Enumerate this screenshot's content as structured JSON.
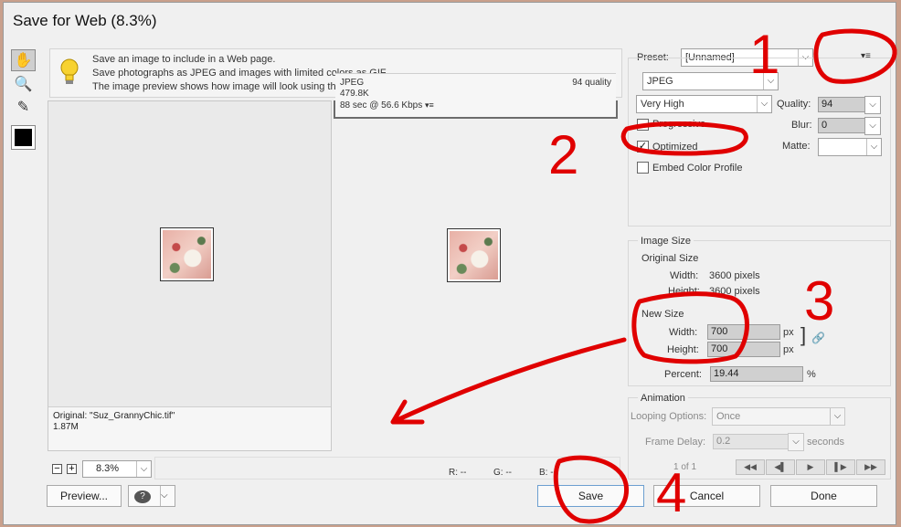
{
  "window": {
    "title": "Save for Web (8.3%)"
  },
  "tools": [
    {
      "name": "hand-tool",
      "glyph": "✋"
    },
    {
      "name": "zoom-tool",
      "glyph": "🔍"
    },
    {
      "name": "eyedropper-tool",
      "glyph": "✎"
    }
  ],
  "info": {
    "lines": [
      "Save an image to include in a Web page.",
      "Save photographs as JPEG and images with limited colors as GIF.",
      "The image preview shows how image will look using the current settings."
    ]
  },
  "original": {
    "caption": "Original: \"Suz_GrannyChic.tif\"",
    "size": "1.87M"
  },
  "optimized": {
    "format": "JPEG",
    "quality_text": "94 quality",
    "size": "479.8K",
    "speed": "88 sec @ 56.6 Kbps"
  },
  "zoom": {
    "value": "8.3%"
  },
  "readout": {
    "r": "R: --",
    "g": "G: --",
    "b": "B: --"
  },
  "buttons": {
    "preview": "Preview...",
    "save": "Save",
    "cancel": "Cancel",
    "done": "Done"
  },
  "settings": {
    "preset_label": "Preset:",
    "preset_value": "[Unnamed]",
    "format": "JPEG",
    "quality_preset": "Very High",
    "quality_label": "Quality:",
    "quality_value": "94",
    "progressive_label": "Progressive",
    "progressive_checked": false,
    "blur_label": "Blur:",
    "blur_value": "0",
    "optimized_label": "Optimized",
    "optimized_checked": true,
    "matte_label": "Matte:",
    "embed_label": "Embed Color Profile",
    "embed_checked": false
  },
  "image_size": {
    "title": "Image Size",
    "original_title": "Original Size",
    "width_label": "Width:",
    "width_value": "3600 pixels",
    "height_label": "Height:",
    "height_value": "3600 pixels",
    "new_title": "New Size",
    "new_width_label": "Width:",
    "new_width": "700",
    "new_height_label": "Height:",
    "new_height": "700",
    "unit": "px",
    "percent_label": "Percent:",
    "percent": "19.44",
    "percent_unit": "%"
  },
  "animation": {
    "title": "Animation",
    "looping_label": "Looping Options:",
    "looping_value": "Once",
    "frame_delay_label": "Frame Delay:",
    "frame_delay_value": "0.2",
    "frame_delay_unit": "seconds",
    "frame_counter": "1 of 1",
    "nav": [
      "◀◀",
      "◀▌",
      "▶",
      "▌▶",
      "▶▶"
    ]
  },
  "annotations": [
    "1",
    "2",
    "3",
    "4"
  ],
  "colors": {
    "annotation": "#e00000",
    "primary_border": "#6c9fd0"
  }
}
